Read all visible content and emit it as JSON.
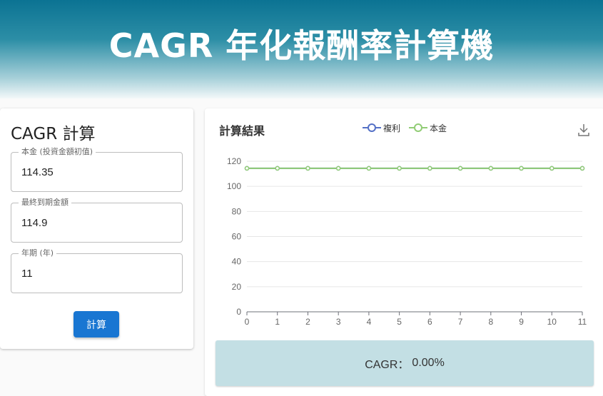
{
  "header": {
    "title": "CAGR 年化報酬率計算機"
  },
  "form": {
    "title": "CAGR 計算",
    "fields": [
      {
        "label": "本金 (投資金額初值)",
        "value": "114.35"
      },
      {
        "label": "最終到期金額",
        "value": "114.9"
      },
      {
        "label": "年期 (年)",
        "value": "11"
      }
    ],
    "submit_label": "計算"
  },
  "result": {
    "title": "計算結果",
    "cagr_label": "CAGR：",
    "cagr_value": "0.00%",
    "download_icon": "download-icon"
  },
  "chart_data": {
    "type": "line",
    "x": [
      0,
      1,
      2,
      3,
      4,
      5,
      6,
      7,
      8,
      9,
      10,
      11
    ],
    "ylim": [
      0,
      120
    ],
    "yticks": [
      0,
      20,
      40,
      60,
      80,
      100,
      120
    ],
    "legend_position": "top",
    "grid": true,
    "series": [
      {
        "name": "複利",
        "color": "#5470c6",
        "values": [
          114.35,
          114.35,
          114.35,
          114.35,
          114.35,
          114.35,
          114.35,
          114.35,
          114.35,
          114.35,
          114.35,
          114.35
        ]
      },
      {
        "name": "本金",
        "color": "#91cc75",
        "values": [
          114.35,
          114.35,
          114.35,
          114.35,
          114.35,
          114.35,
          114.35,
          114.35,
          114.35,
          114.35,
          114.35,
          114.35
        ]
      }
    ]
  }
}
